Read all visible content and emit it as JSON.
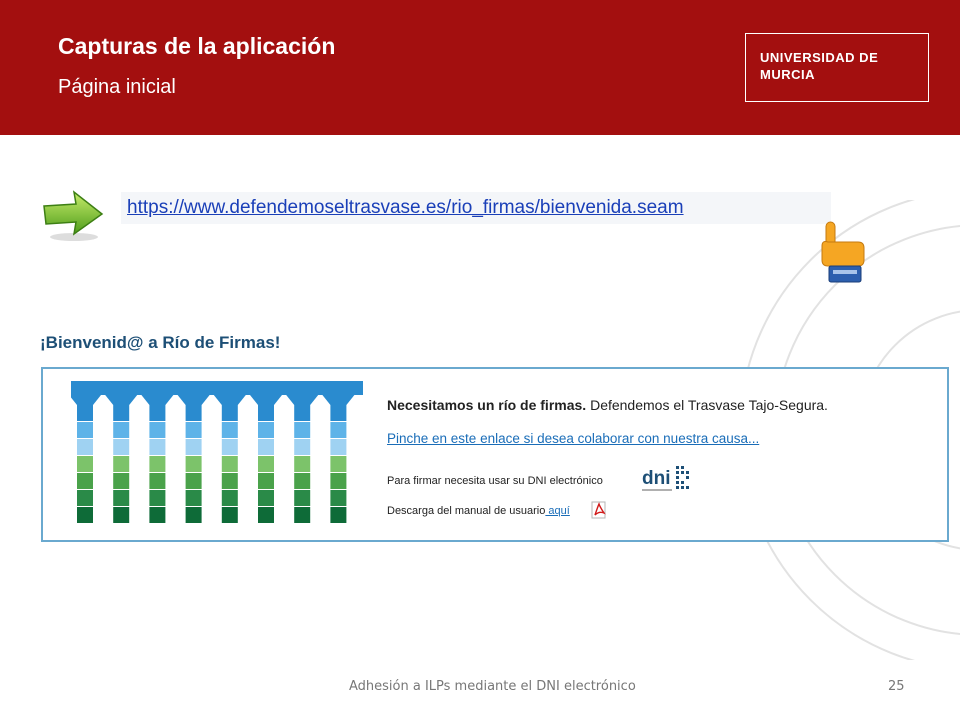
{
  "header": {
    "title": "Capturas de la aplicación",
    "subtitle": "Página inicial",
    "logo": {
      "line1": "UNIVERSIDAD DE",
      "line2": "MURCIA"
    }
  },
  "url": {
    "text": "https://www.defendemoseltrasvase.es/rio_firmas/bienvenida.seam"
  },
  "icons": {
    "arrow": "green-arrow-icon",
    "hand": "pointing-hand-icon",
    "pdf": "pdf-icon",
    "dni": "dni-logo-icon"
  },
  "app": {
    "welcome": "¡Bienvenid@ a Río de Firmas!",
    "heading_bold": "Necesitamos un río de firmas.",
    "heading_rest": " Defendemos el Trasvase Tajo-Segura.",
    "link": "Pinche en este enlace si desea colaborar con nuestra causa...",
    "dni_text": "Para firmar necesita usar su DNI electrónico",
    "dni_logo_text": "dni",
    "manual_text": "Descarga del manual de usuario",
    "manual_link": " aquí"
  },
  "colors": {
    "header_bg": "#a30f0f",
    "link": "#1a3fb8",
    "panel_border": "#6aa9cf"
  },
  "footer": {
    "text": "Adhesión a ILPs mediante el DNI electrónico",
    "page": "25"
  }
}
